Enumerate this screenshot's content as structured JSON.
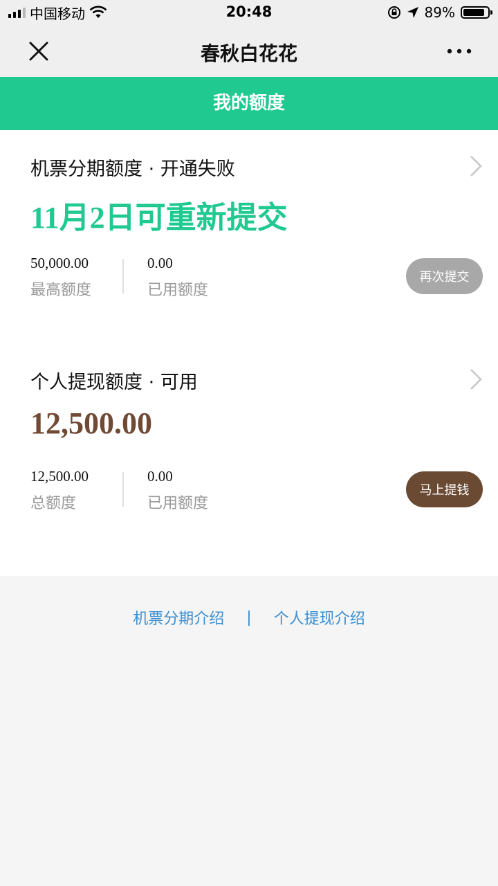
{
  "status_bar": {
    "carrier": "中国移动",
    "time": "20:48",
    "battery_percent": "89%",
    "battery_level": 0.89
  },
  "nav": {
    "title": "春秋白花花"
  },
  "header": {
    "title": "我的额度"
  },
  "cards": [
    {
      "title": "机票分期额度 · 开通失败",
      "headline": "11月2日可重新提交",
      "stat1_value": "50,000.00",
      "stat1_label": "最高额度",
      "stat2_value": "0.00",
      "stat2_label": "已用额度",
      "button_label": "再次提交"
    },
    {
      "title": "个人提现额度 · 可用",
      "headline": "12,500.00",
      "stat1_value": "12,500.00",
      "stat1_label": "总额度",
      "stat2_value": "0.00",
      "stat2_label": "已用额度",
      "button_label": "马上提钱"
    }
  ],
  "footer": {
    "link1": "机票分期介绍",
    "separator": "|",
    "link2": "个人提现介绍"
  },
  "colors": {
    "accent_green": "#20c98f",
    "brown": "#704a34",
    "link_blue": "#3d8ecf"
  },
  "icons": [
    "signal-icon",
    "wifi-icon",
    "lock-rotation-icon",
    "location-arrow-icon",
    "battery-icon",
    "close-icon",
    "more-icon",
    "chevron-right-icon"
  ]
}
